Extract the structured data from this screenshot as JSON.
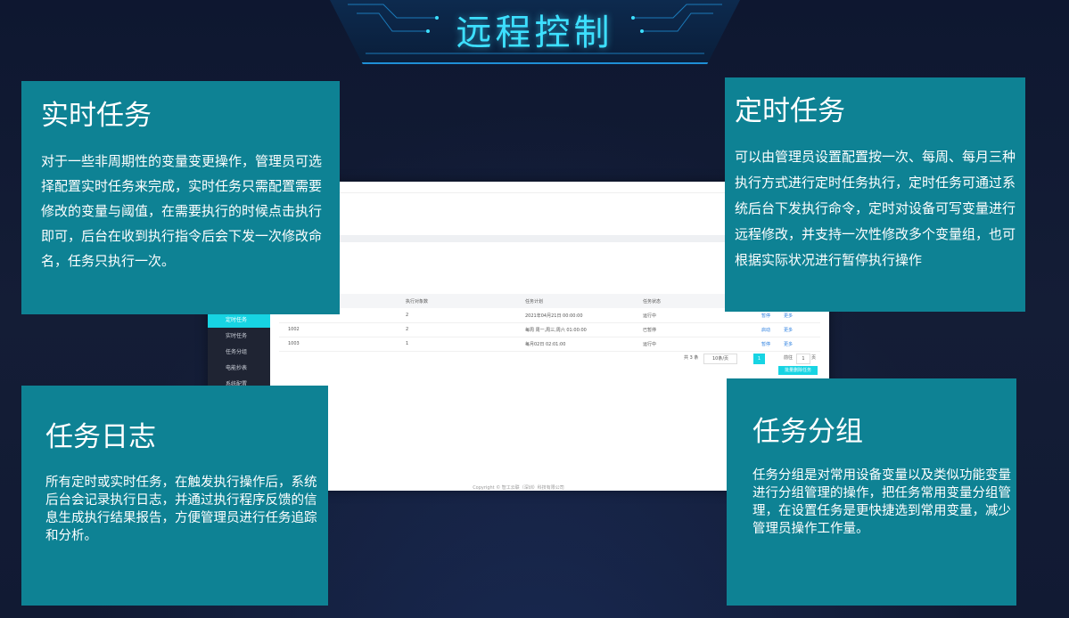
{
  "header": {
    "title": "远程控制"
  },
  "cards": {
    "realtime": {
      "title": "实时任务",
      "body": "对于一些非周期性的变量变更操作，管理员可选择配置实时任务来完成，实时任务只需配置需要修改的变量与阈值，在需要执行的时候点击执行即可，后台在收到执行指令后会下发一次修改命名，任务只执行一次。"
    },
    "timed": {
      "title": "定时任务",
      "body": "可以由管理员设置配置按一次、每周、每月三种执行方式进行定时任务执行，定时任务可通过系统后台下发执行命令，定时对设备可写变量进行远程修改，并支持一次性修改多个变量组，也可根据实际状况进行暂停执行操作"
    },
    "log": {
      "title": "任务日志",
      "body": "所有定时或实时任务，在触发执行操作后，系统后台会记录执行日志，并通过执行程序反馈的信息生成执行结果报告，方便管理员进行任务追踪和分析。"
    },
    "group": {
      "title": "任务分组",
      "body": "任务分组是对常用设备变量以及类似功能变量进行分组管理的操作，把任务常用变量分组管理，在设置任务是更快捷选到常用变量，减少管理员操作工作量。"
    }
  },
  "screenshot": {
    "sidebar": {
      "items": [
        "定时任务",
        "实时任务",
        "任务分组",
        "电能抄表",
        "系统配置"
      ]
    },
    "table": {
      "headers": [
        "执行对象数",
        "任务计划",
        "任务状态"
      ],
      "rows": [
        {
          "id": "",
          "count": "2",
          "plan": "2021年04月21日 00:00:00",
          "status": "运行中",
          "actions": [
            "暂停",
            "更多"
          ]
        },
        {
          "id": "1002",
          "count": "2",
          "plan": "每周 周一,周三,周六 01:00:00",
          "status": "已暂停",
          "actions": [
            "启动",
            "更多"
          ]
        },
        {
          "id": "1003",
          "count": "1",
          "plan": "每月02日 02:01:00",
          "status": "运行中",
          "actions": [
            "暂停",
            "更多"
          ]
        }
      ]
    },
    "pager": {
      "total": "共 3 条",
      "page_size": "10条/页",
      "current": "1",
      "goto_label": "前往",
      "goto_value": "1",
      "goto_suffix": "页"
    },
    "action_button": "批量删除任务",
    "footer": "Copyright © 智工云联（深圳）科技有限公司"
  },
  "colors": {
    "card_bg": "#0e8294",
    "title_glow": "#3de0ff",
    "accent": "#17d4e3"
  }
}
